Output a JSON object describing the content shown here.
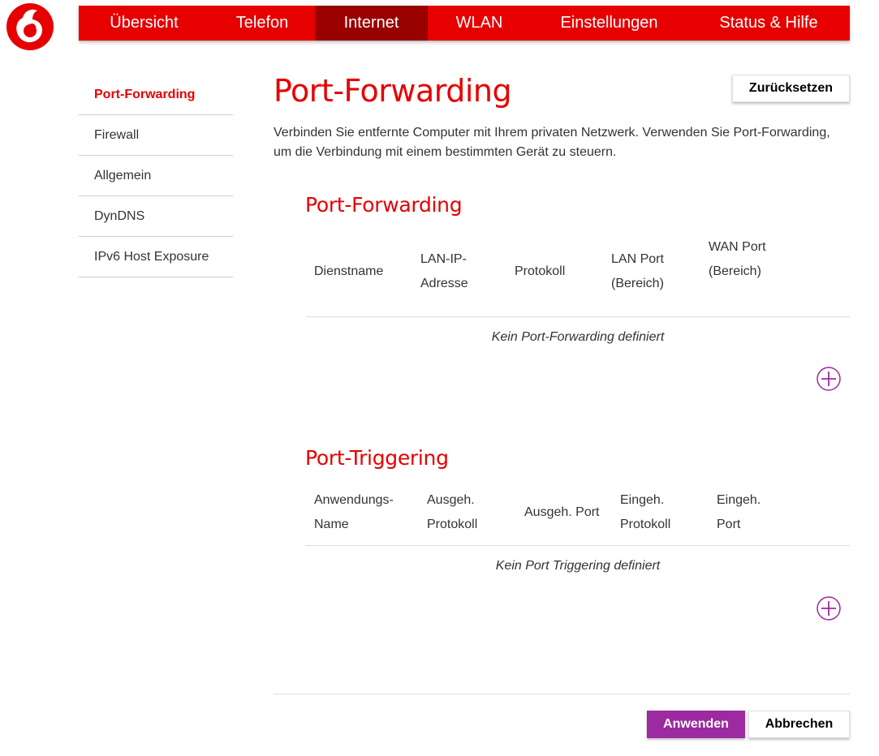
{
  "brand": {
    "primary": "#e60000",
    "active_nav": "#990000",
    "accent": "#9c2aa0",
    "logo_icon": "vodafone-logo"
  },
  "topnav": {
    "items": [
      {
        "label": "Übersicht"
      },
      {
        "label": "Telefon"
      },
      {
        "label": "Internet",
        "active": true
      },
      {
        "label": "WLAN"
      },
      {
        "label": "Einstellungen"
      },
      {
        "label": "Status & Hilfe"
      }
    ]
  },
  "sidebar": {
    "items": [
      {
        "label": "Port-Forwarding",
        "active": true
      },
      {
        "label": "Firewall"
      },
      {
        "label": "Allgemein"
      },
      {
        "label": "DynDNS"
      },
      {
        "label": "IPv6 Host Exposure"
      }
    ]
  },
  "page": {
    "title": "Port-Forwarding",
    "reset_label": "Zurücksetzen",
    "intro": "Verbinden Sie entfernte Computer mit Ihrem privaten Netzwerk. Verwenden Sie Port-Forwarding, um die Verbindung mit einem bestimmten Gerät zu steuern."
  },
  "port_forwarding": {
    "title": "Port-Forwarding",
    "columns": [
      "Dienstname",
      "LAN-IP-Adresse",
      "Protokoll",
      "LAN Port (Bereich)",
      "WAN Port (Bereich)"
    ],
    "empty_text": "Kein Port-Forwarding definiert",
    "add_icon": "plus-circle-icon"
  },
  "port_triggering": {
    "title": "Port-Triggering",
    "columns": [
      "Anwendungs-Name",
      "Ausgeh. Protokoll",
      "Ausgeh. Port",
      "Eingeh. Protokoll",
      "Eingeh. Port"
    ],
    "empty_text": "Kein Port Triggering definiert",
    "add_icon": "plus-circle-icon"
  },
  "footer": {
    "apply_label": "Anwenden",
    "cancel_label": "Abbrechen"
  }
}
